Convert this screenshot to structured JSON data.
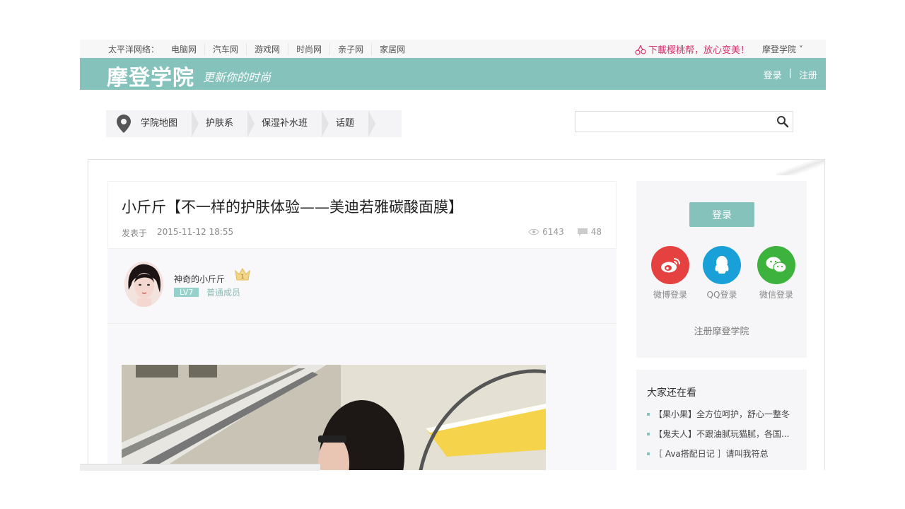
{
  "network": {
    "label": "太平洋网络：",
    "links": [
      "电脑网",
      "汽车网",
      "游戏网",
      "时尚网",
      "亲子网",
      "家居网"
    ],
    "promo": "下載樱桃帮，放心变美！",
    "academy_menu": "摩登学院 ˅"
  },
  "brand": {
    "logo": "摩登学院",
    "slogan": "更新你的时尚",
    "login": "登录",
    "separator": "|",
    "register": "注册",
    "color": "#85c2bb"
  },
  "breadcrumb": [
    "学院地图",
    "护肤系",
    "保湿补水班",
    "话题"
  ],
  "search": {
    "placeholder": ""
  },
  "article": {
    "title": "小斤斤【不一样的护肤体验——美迪若雅碳酸面膜】",
    "published_label": "发表于",
    "published_time": "2015-11-12 18:55",
    "views": "6143",
    "comments": "48",
    "author": {
      "name": "神奇的小斤斤",
      "crown_number": "1",
      "level": "LV7",
      "member_type": "普通成员"
    }
  },
  "sidebar": {
    "login_button": "登录",
    "social": [
      {
        "label": "微博登录",
        "icon": "weibo-icon",
        "color": "#e64141"
      },
      {
        "label": "QQ登录",
        "icon": "qq-icon",
        "color": "#1aa0d8"
      },
      {
        "label": "微信登录",
        "icon": "wechat-icon",
        "color": "#3db33d"
      }
    ],
    "register_link": "注册摩登学院",
    "hot_title": "大家还在看",
    "hot_items": [
      "【果小果】全方位呵护，舒心一整冬",
      "【鬼夫人】不跟油腻玩猫腻，各国...",
      "［ Ava搭配日记 ］请叫我符总"
    ]
  }
}
